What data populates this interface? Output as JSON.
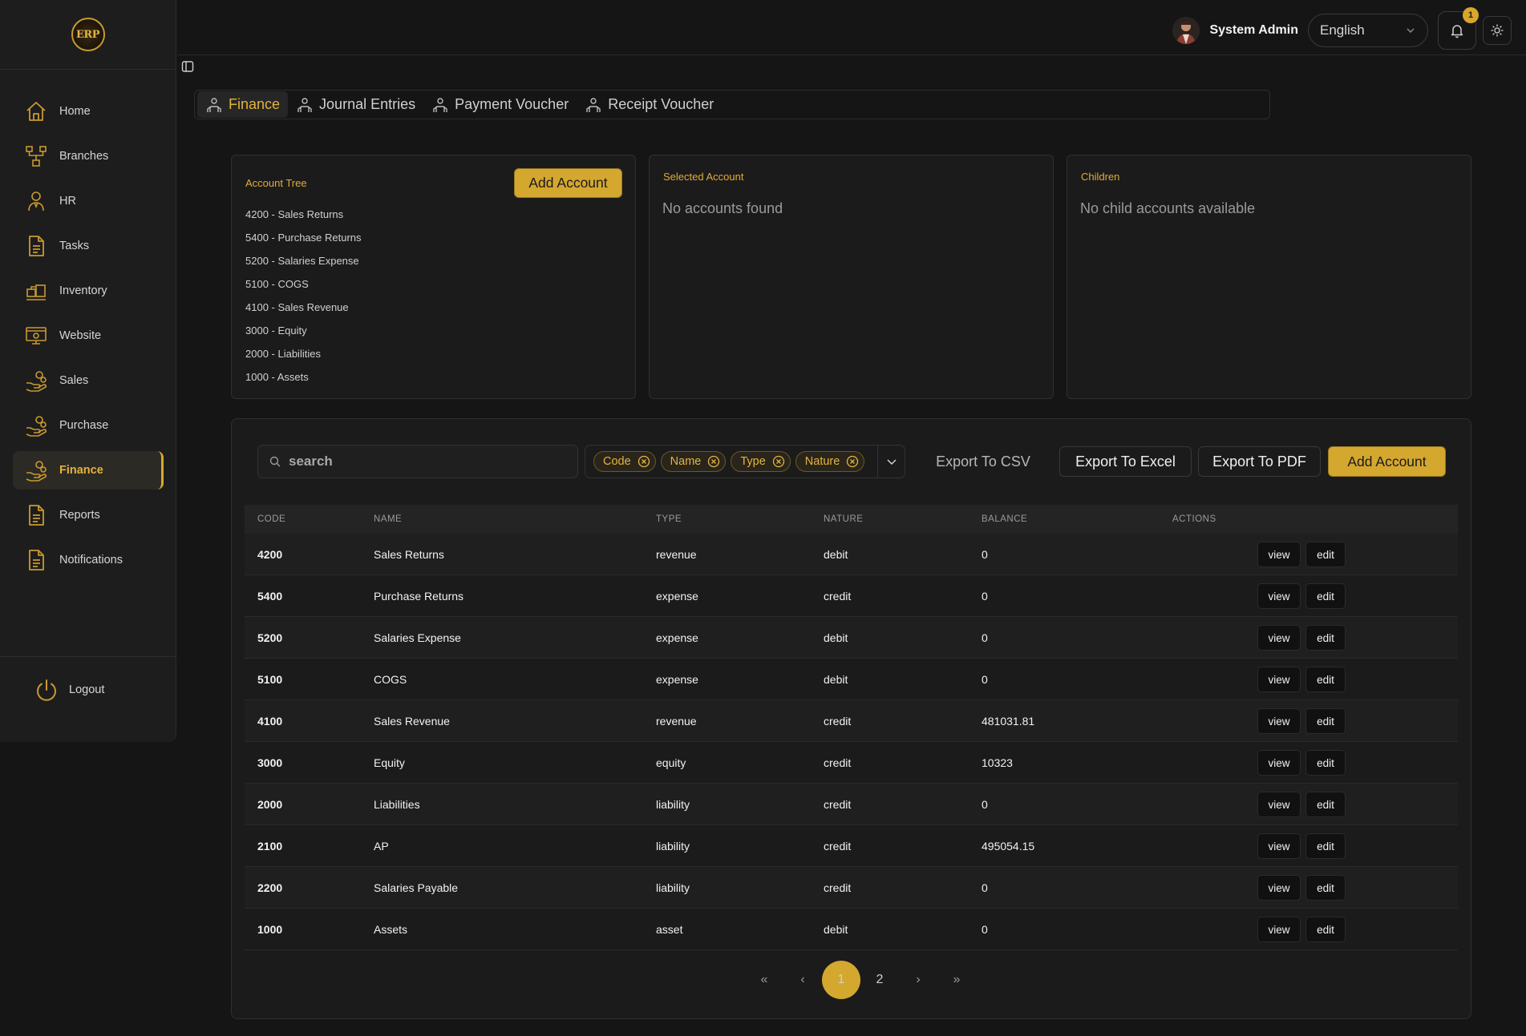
{
  "app": {
    "logo_text": "ERP"
  },
  "sidebar": {
    "items": [
      {
        "label": "Home",
        "icon": "home-icon"
      },
      {
        "label": "Branches",
        "icon": "branches-icon"
      },
      {
        "label": "HR",
        "icon": "hr-icon"
      },
      {
        "label": "Tasks",
        "icon": "document-icon"
      },
      {
        "label": "Inventory",
        "icon": "inventory-icon"
      },
      {
        "label": "Website",
        "icon": "website-icon"
      },
      {
        "label": "Sales",
        "icon": "hand-coins-icon"
      },
      {
        "label": "Purchase",
        "icon": "hand-coins-icon"
      },
      {
        "label": "Finance",
        "icon": "hand-coins-icon",
        "active": true
      },
      {
        "label": "Reports",
        "icon": "document-icon"
      },
      {
        "label": "Notifications",
        "icon": "document-icon"
      }
    ],
    "logout_label": "Logout"
  },
  "header": {
    "user_name": "System Admin",
    "language": "English",
    "notification_count": "1"
  },
  "tabs": [
    {
      "label": "Finance",
      "active": true
    },
    {
      "label": "Journal Entries"
    },
    {
      "label": "Payment Voucher"
    },
    {
      "label": "Receipt Voucher"
    }
  ],
  "account_tree": {
    "title": "Account Tree",
    "add_button": "Add Account",
    "items": [
      "4200 - Sales Returns",
      "5400 - Purchase Returns",
      "5200 - Salaries Expense",
      "5100 - COGS",
      "4100 - Sales Revenue",
      "3000 - Equity",
      "2000 - Liabilities",
      "1000 - Assets"
    ]
  },
  "selected_account": {
    "title": "Selected Account",
    "empty": "No accounts found"
  },
  "children": {
    "title": "Children",
    "empty": "No child accounts available"
  },
  "toolbar": {
    "search_placeholder": "search",
    "chips": [
      "Code",
      "Name",
      "Type",
      "Nature"
    ],
    "export_csv": "Export To CSV",
    "export_excel": "Export To Excel",
    "export_pdf": "Export To PDF",
    "add_account": "Add Account"
  },
  "table": {
    "columns": [
      "CODE",
      "NAME",
      "TYPE",
      "NATURE",
      "BALANCE",
      "ACTIONS"
    ],
    "view_label": "view",
    "edit_label": "edit",
    "rows": [
      {
        "code": "4200",
        "name": "Sales Returns",
        "type": "revenue",
        "nature": "debit",
        "balance": "0"
      },
      {
        "code": "5400",
        "name": "Purchase Returns",
        "type": "expense",
        "nature": "credit",
        "balance": "0"
      },
      {
        "code": "5200",
        "name": "Salaries Expense",
        "type": "expense",
        "nature": "debit",
        "balance": "0"
      },
      {
        "code": "5100",
        "name": "COGS",
        "type": "expense",
        "nature": "debit",
        "balance": "0"
      },
      {
        "code": "4100",
        "name": "Sales Revenue",
        "type": "revenue",
        "nature": "credit",
        "balance": "481031.81"
      },
      {
        "code": "3000",
        "name": "Equity",
        "type": "equity",
        "nature": "credit",
        "balance": "10323"
      },
      {
        "code": "2000",
        "name": "Liabilities",
        "type": "liability",
        "nature": "credit",
        "balance": "0"
      },
      {
        "code": "2100",
        "name": "AP",
        "type": "liability",
        "nature": "credit",
        "balance": "495054.15"
      },
      {
        "code": "2200",
        "name": "Salaries Payable",
        "type": "liability",
        "nature": "credit",
        "balance": "0"
      },
      {
        "code": "1000",
        "name": "Assets",
        "type": "asset",
        "nature": "debit",
        "balance": "0"
      }
    ]
  },
  "pagination": {
    "first": "«",
    "prev": "‹",
    "pages": [
      "1",
      "2"
    ],
    "current": "1",
    "next": "›",
    "last": "»"
  },
  "colors": {
    "accent": "#d4a72f",
    "background": "#151515",
    "panel": "#1b1b1b"
  }
}
